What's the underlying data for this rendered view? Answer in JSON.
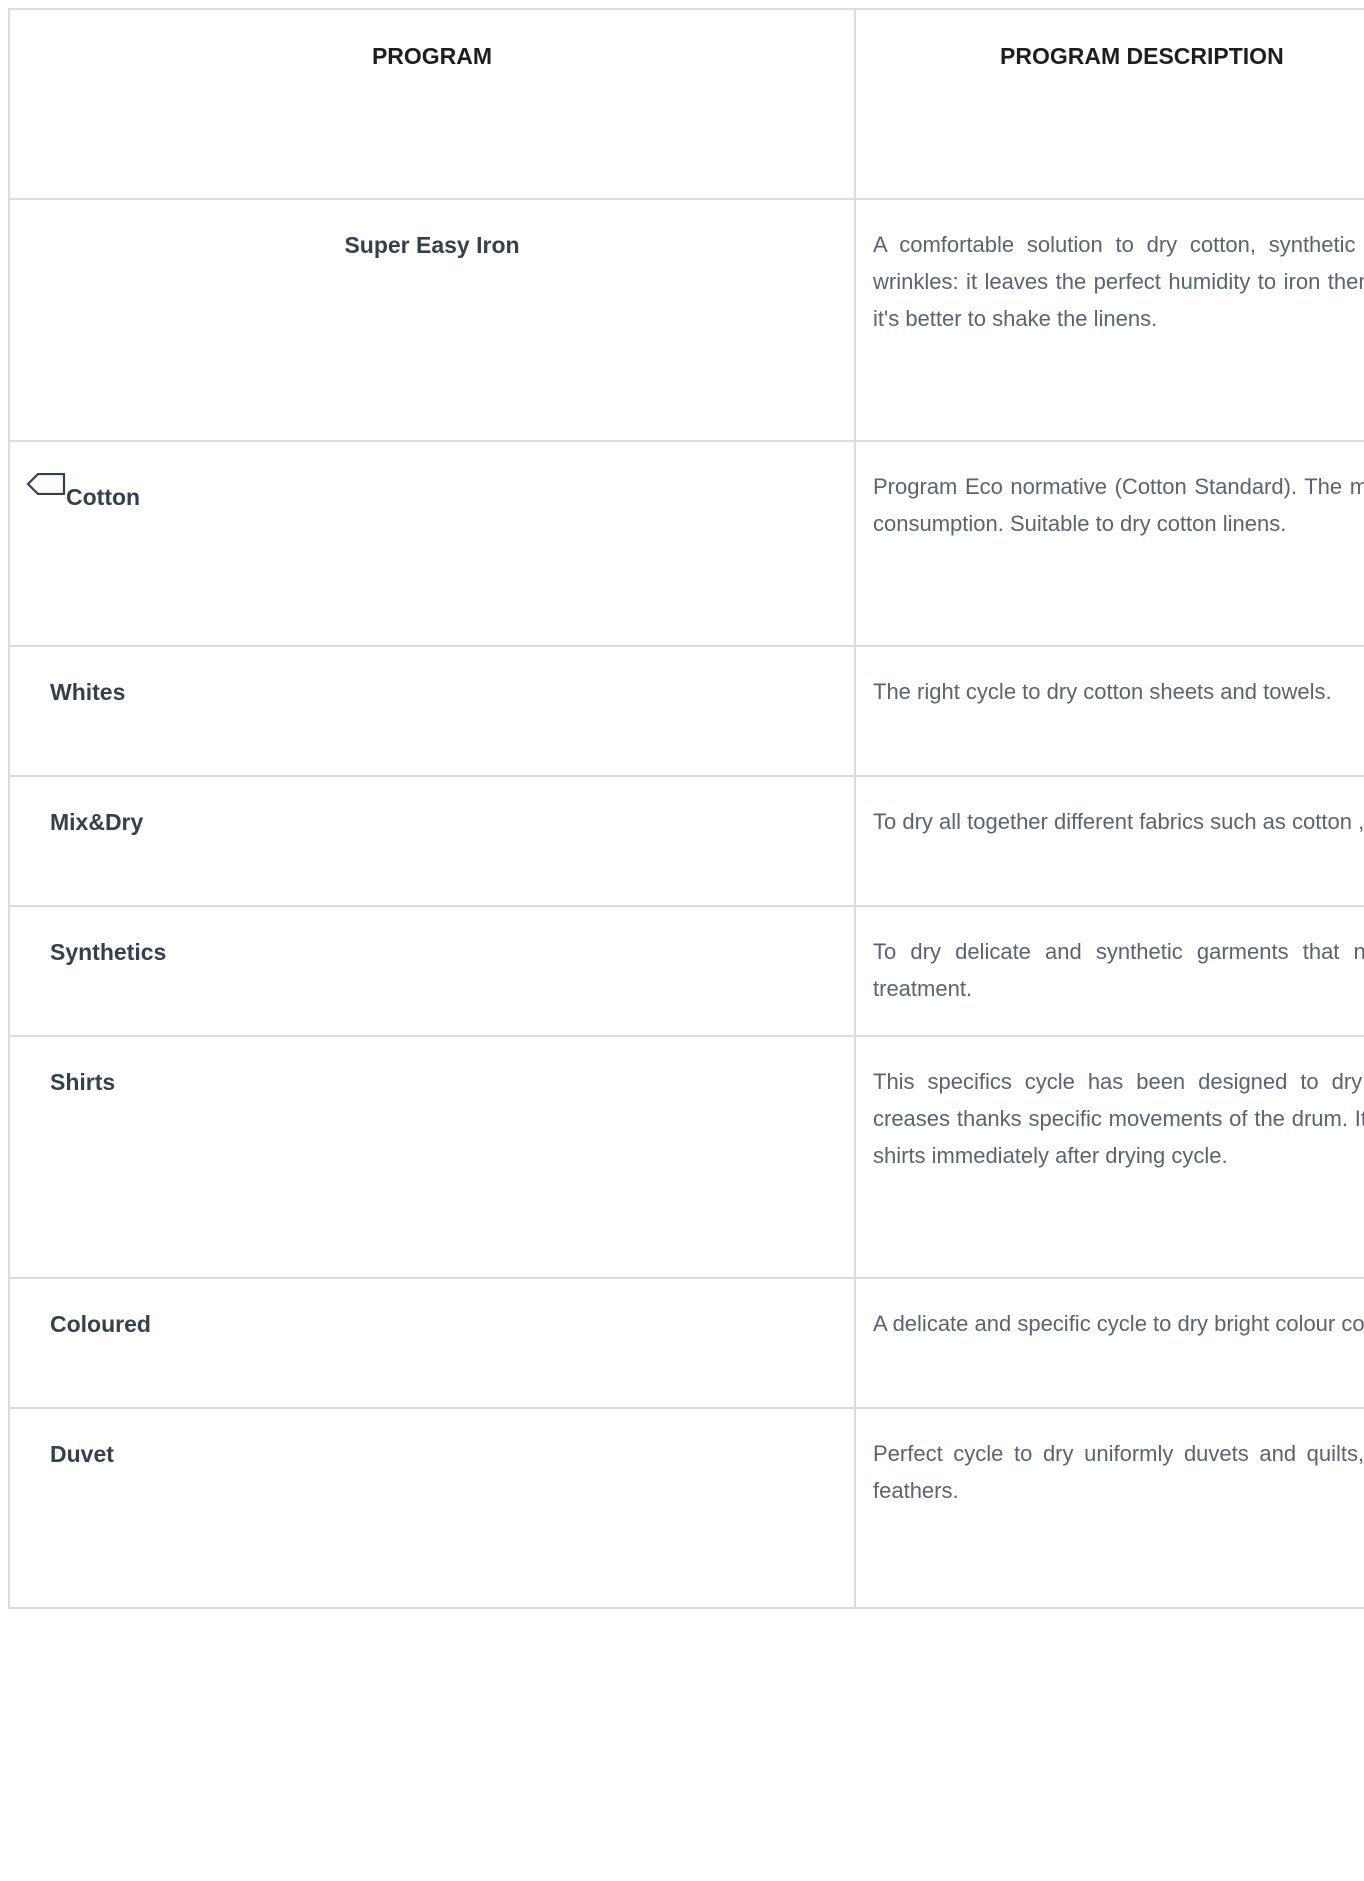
{
  "table": {
    "headers": [
      "PROGRAM",
      "PROGRAM DESCRIPTION"
    ],
    "rows": [
      {
        "program": "Super Easy Iron",
        "description": "A comfortable solution to dry cotton, synthetic and mixed fabrics minimazing wrinkles: it leaves the perfect humidity to iron them in an easy way. Before drying it's better to shake the linens."
      },
      {
        "program": "Cotton",
        "icon": "tag-icon",
        "description": "Program Eco normative (Cotton Standard). The most efficient program for energy consumption. Suitable to dry cotton linens."
      },
      {
        "program": "Whites",
        "description": "The right cycle to dry cotton sheets and towels."
      },
      {
        "program": "Mix&Dry",
        "description": "To dry all together different fabrics such as cotton ,linen, mix, synthetics."
      },
      {
        "program": "Synthetics",
        "description": "To dry delicate and synthetic garments that need an accurate and specific treatment."
      },
      {
        "program": "Shirts",
        "description": "This specifics cycle has been designed to dry shirts minimizing tangles and creases thanks specific movements of the drum. It's recommended to take out the shirts immediately after drying cycle."
      },
      {
        "program": "Coloured",
        "description": "A delicate and specific cycle to dry bright colour cotton or syntethics garments."
      },
      {
        "program": "Duvet",
        "description": "Perfect cycle to dry uniformly duvets and quilts, revitalizing the smoothness of feathers."
      }
    ]
  }
}
